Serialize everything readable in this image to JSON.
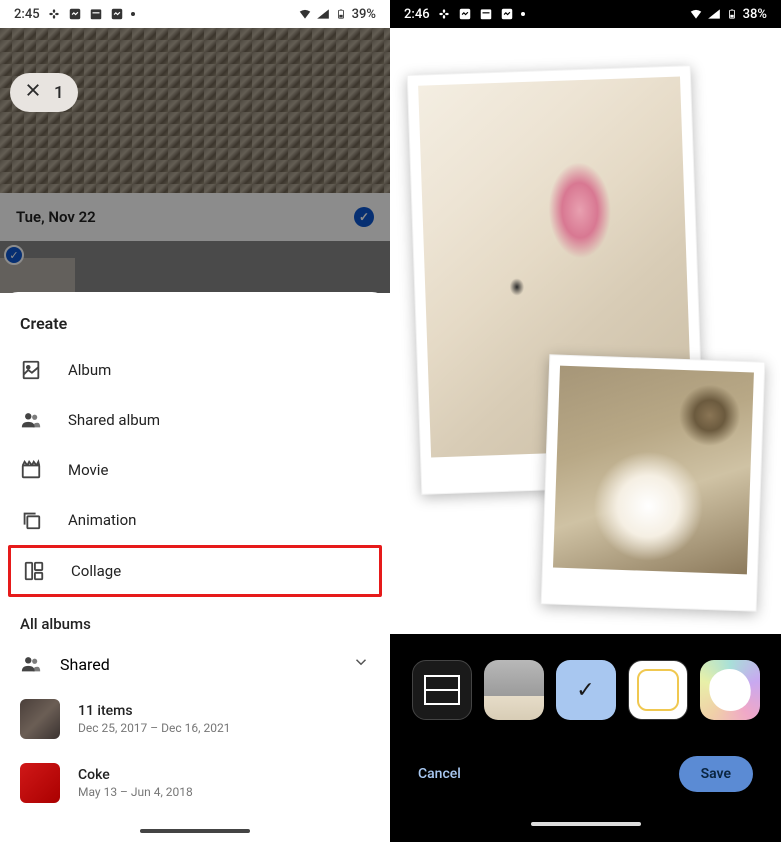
{
  "left_phone": {
    "status": {
      "time": "2:45",
      "battery": "39%"
    },
    "selection_count": "1",
    "date_header": "Tue, Nov 22",
    "sheet": {
      "title": "Create",
      "menu": [
        {
          "label": "Album",
          "icon": "album-icon"
        },
        {
          "label": "Shared album",
          "icon": "shared-album-icon"
        },
        {
          "label": "Movie",
          "icon": "movie-icon"
        },
        {
          "label": "Animation",
          "icon": "animation-icon"
        },
        {
          "label": "Collage",
          "icon": "collage-icon",
          "highlighted": true
        }
      ],
      "section_title": "All albums",
      "shared_label": "Shared",
      "albums": [
        {
          "name": "11 items",
          "subtitle": "Dec 25, 2017 – Dec 16, 2021"
        },
        {
          "name": "Coke",
          "subtitle": "May 13 – Jun 4, 2018"
        }
      ]
    }
  },
  "right_phone": {
    "status": {
      "time": "2:46",
      "battery": "38%"
    },
    "styles_selected_index": 2,
    "actions": {
      "cancel": "Cancel",
      "save": "Save"
    }
  }
}
